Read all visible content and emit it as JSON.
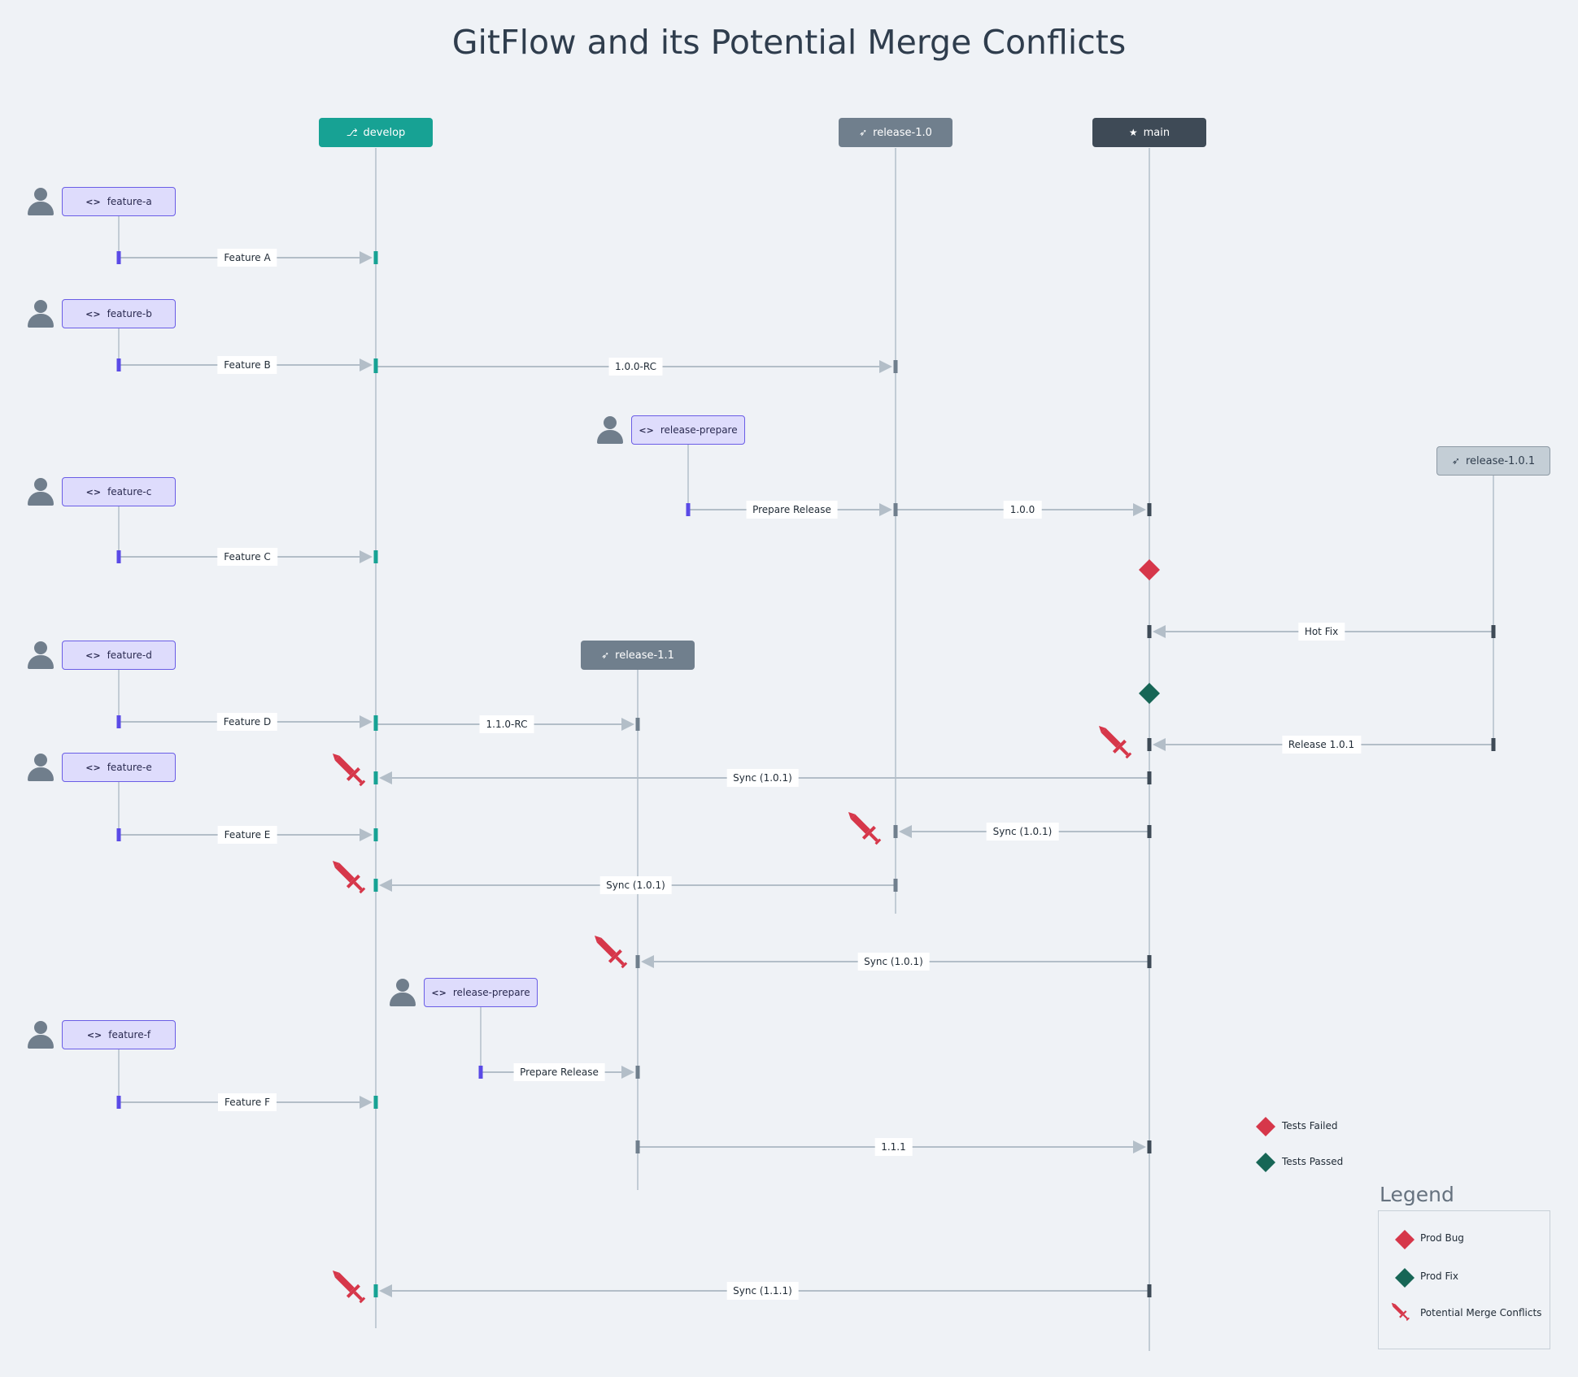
{
  "title": "GitFlow and its Potential Merge Conflicts",
  "colors": {
    "develop": "#17a294",
    "release": "#707f8d",
    "main": "#3e4a56",
    "hotfix": "#c4ced6",
    "feature_fill": "#dedcfc",
    "feature_border": "#6a5de6",
    "lane": "#c2ccd5",
    "prod_bug": "#d6374a",
    "prod_fix": "#176656",
    "conflict": "#d6374a"
  },
  "branches": {
    "develop": {
      "label": "develop",
      "icon": "git-branch-icon"
    },
    "release_1_0": {
      "label": "release-1.0",
      "icon": "rocket-icon"
    },
    "main": {
      "label": "main",
      "icon": "star-icon"
    },
    "release_1_0_1": {
      "label": "release-1.0.1",
      "icon": "rocket-icon"
    },
    "release_1_1": {
      "label": "release-1.1",
      "icon": "rocket-icon"
    }
  },
  "features": [
    {
      "label": "feature-a",
      "icon": "code-icon"
    },
    {
      "label": "feature-b",
      "icon": "code-icon"
    },
    {
      "label": "release-prepare",
      "icon": "code-icon"
    },
    {
      "label": "feature-c",
      "icon": "code-icon"
    },
    {
      "label": "feature-d",
      "icon": "code-icon"
    },
    {
      "label": "feature-e",
      "icon": "code-icon"
    },
    {
      "label": "release-prepare",
      "icon": "code-icon"
    },
    {
      "label": "feature-f",
      "icon": "code-icon"
    }
  ],
  "merges": [
    {
      "label": "Feature A"
    },
    {
      "label": "Feature B"
    },
    {
      "label": "1.0.0-RC"
    },
    {
      "label": "Prepare Release"
    },
    {
      "label": "1.0.0"
    },
    {
      "label": "Feature C"
    },
    {
      "label": "Hot Fix"
    },
    {
      "label": "Feature D"
    },
    {
      "label": "1.1.0-RC"
    },
    {
      "label": "Release 1.0.1"
    },
    {
      "label": "Sync (1.0.1)"
    },
    {
      "label": "Feature E"
    },
    {
      "label": "Sync (1.0.1)"
    },
    {
      "label": "Sync (1.0.1)"
    },
    {
      "label": "Sync (1.0.1)"
    },
    {
      "label": "Prepare Release"
    },
    {
      "label": "Feature F"
    },
    {
      "label": "1.1.1"
    },
    {
      "label": "Sync (1.1.1)"
    }
  ],
  "markers": [
    {
      "type": "tests-failed"
    },
    {
      "type": "tests-passed"
    }
  ],
  "key": {
    "tests_failed": "Tests Failed",
    "tests_passed": "Tests Passed"
  },
  "legend": {
    "title": "Legend",
    "items": [
      {
        "label": "Prod Bug",
        "icon": "diamond-red-icon"
      },
      {
        "label": "Prod Fix",
        "icon": "diamond-green-icon"
      },
      {
        "label": "Potential Merge Conflicts",
        "icon": "sword-icon"
      }
    ]
  }
}
